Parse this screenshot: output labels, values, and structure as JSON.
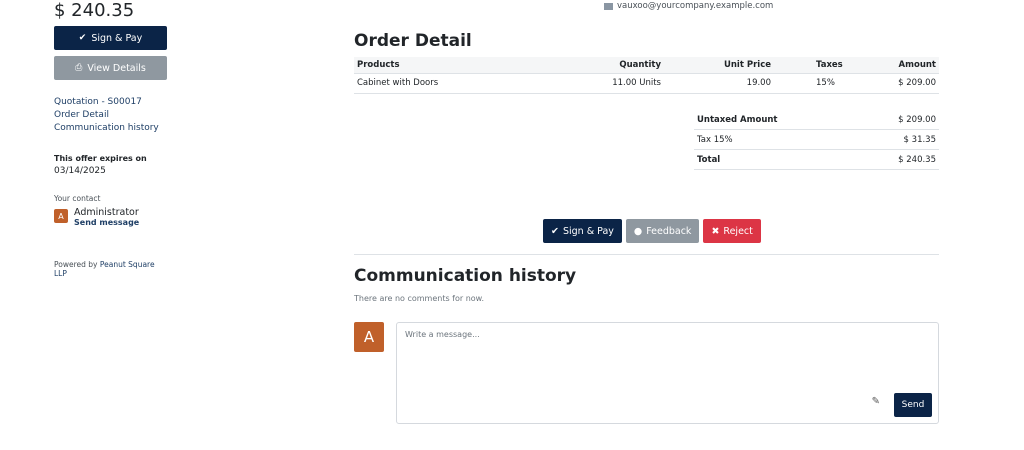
{
  "sidebar": {
    "total": "$ 240.35",
    "sign_pay_label": "Sign & Pay",
    "view_details_label": "View Details",
    "links": [
      "Quotation - S00017",
      "Order Detail",
      "Communication history"
    ],
    "expires_label": "This offer expires on",
    "expires_date": "03/14/2025",
    "contact_label": "Your contact",
    "contact_initial": "A",
    "contact_name": "Administrator",
    "contact_send": "Send message",
    "powered_prefix": "Powered by",
    "powered_company": "Peanut Square LLP"
  },
  "header": {
    "email": "vauxoo@yourcompany.example.com"
  },
  "order": {
    "title": "Order Detail",
    "columns": [
      "Products",
      "Quantity",
      "Unit Price",
      "Taxes",
      "Amount"
    ],
    "lines": [
      {
        "product": "Cabinet with Doors",
        "quantity": "11.00 Units",
        "unit_price": "19.00",
        "taxes": "15%",
        "amount": "$ 209.00"
      }
    ],
    "totals": {
      "untaxed_label": "Untaxed Amount",
      "untaxed_value": "$ 209.00",
      "tax_label": "Tax 15%",
      "tax_value": "$ 31.35",
      "total_label": "Total",
      "total_value": "$ 240.35"
    }
  },
  "actions": {
    "sign_pay": "Sign & Pay",
    "feedback": "Feedback",
    "reject": "Reject"
  },
  "communication": {
    "title": "Communication history",
    "empty": "There are no comments for now.",
    "avatar_initial": "A",
    "placeholder": "Write a message...",
    "send": "Send"
  },
  "colors": {
    "primary": "#0b2447",
    "secondary": "#8f98a0",
    "danger": "#dc3545",
    "avatar": "#c0602a"
  }
}
